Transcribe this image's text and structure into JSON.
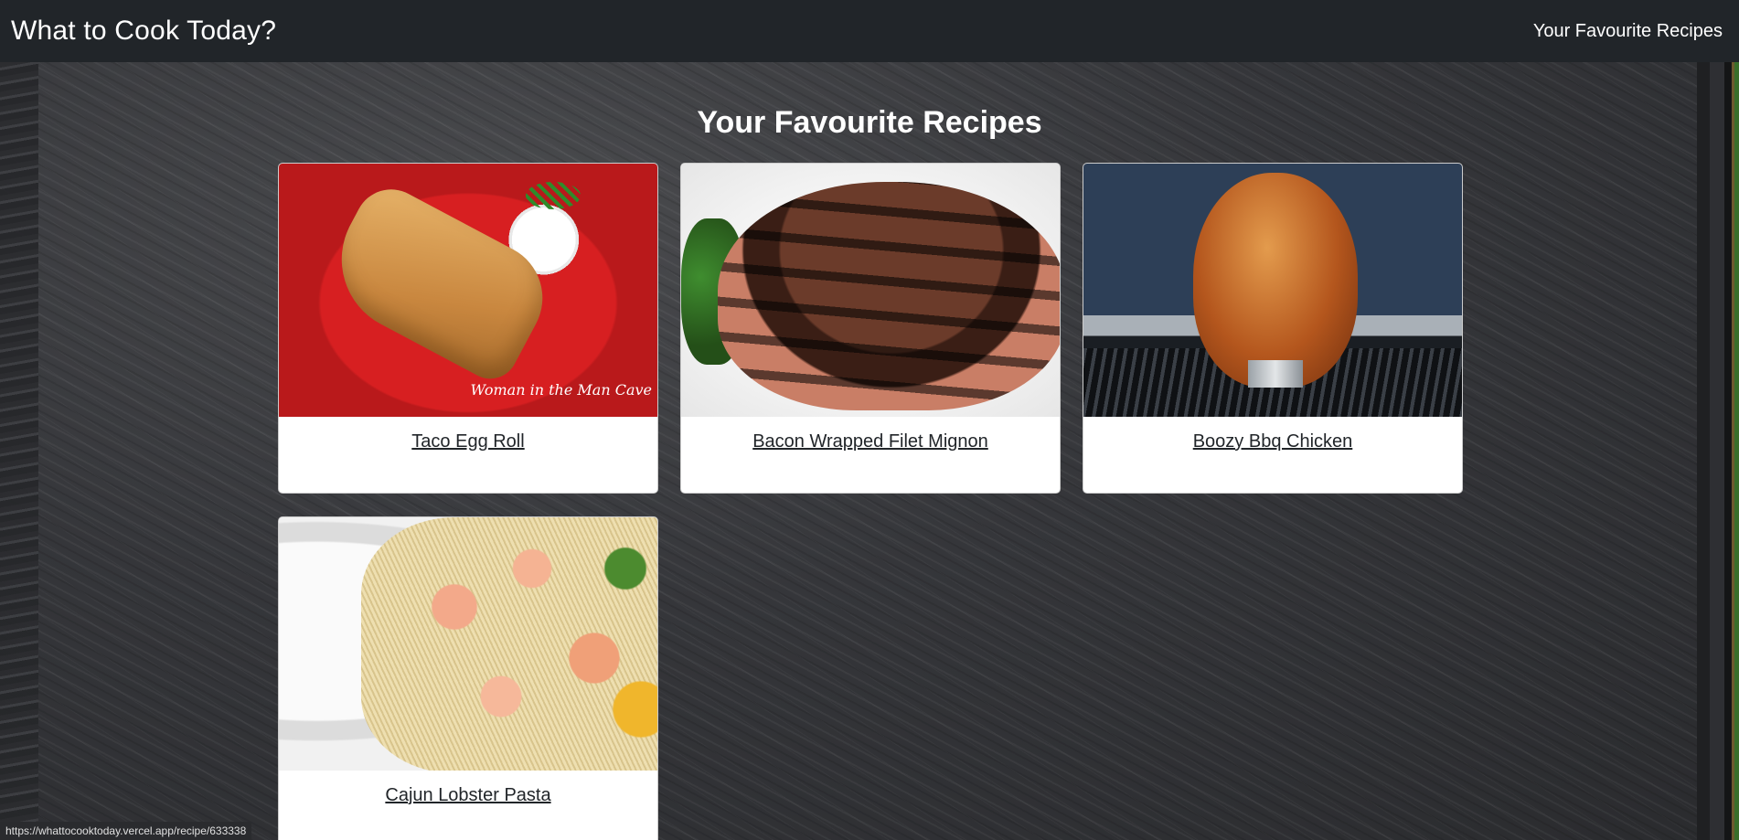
{
  "navbar": {
    "brand": "What to Cook Today?",
    "link": "Your Favourite Recipes"
  },
  "main": {
    "heading": "Your Favourite Recipes",
    "recipes": [
      {
        "title": "Taco Egg Roll",
        "image": "taco-egg-roll-photo",
        "watermark": "Woman in the Man Cave"
      },
      {
        "title": "Bacon Wrapped Filet Mignon",
        "image": "bacon-wrapped-filet-photo"
      },
      {
        "title": "Boozy Bbq Chicken",
        "image": "bbq-chicken-photo"
      },
      {
        "title": "Cajun Lobster Pasta",
        "image": "lobster-pasta-photo"
      }
    ]
  },
  "statusbar": {
    "url": "https://whattocooktoday.vercel.app/recipe/633338"
  },
  "colors": {
    "navbar_bg": "#212529",
    "text_on_dark": "#ffffff",
    "card_bg": "#ffffff",
    "card_title": "#212529"
  }
}
